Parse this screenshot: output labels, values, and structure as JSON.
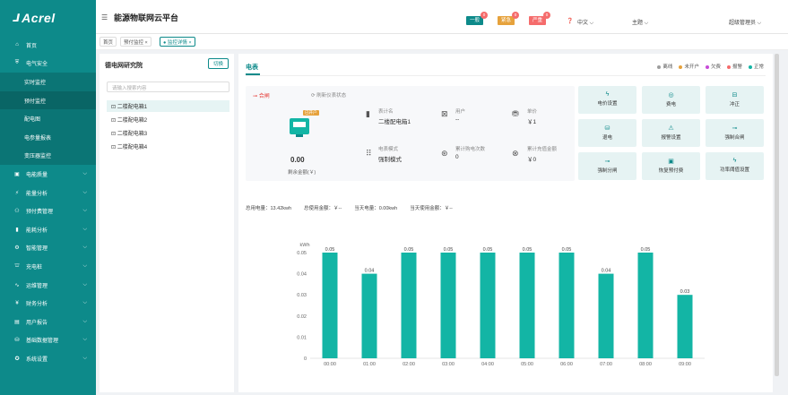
{
  "app": {
    "logo": "Acrel",
    "title": "能源物联网云平台"
  },
  "header": {
    "alarms": [
      {
        "label": "一般",
        "count": "0",
        "color": "#0d8a8a"
      },
      {
        "label": "紧急",
        "count": "0",
        "color": "#e6a23c"
      },
      {
        "label": "严重",
        "count": "0",
        "color": "#f56c6c"
      }
    ],
    "language": "中文",
    "theme": "主题",
    "user": "超级管理员"
  },
  "tags": [
    {
      "label": "首页"
    },
    {
      "label": "预付监控 ×"
    },
    {
      "label": "● 监控详情 ×"
    }
  ],
  "sidebar": {
    "items": [
      {
        "label": "首页",
        "icon": "home-icon"
      },
      {
        "label": "电气安全",
        "icon": "shield-icon"
      },
      {
        "label": "实时监控",
        "icon": "",
        "sub": true
      },
      {
        "label": "预付监控",
        "icon": "",
        "sub": true
      },
      {
        "label": "配电图",
        "icon": "",
        "sub": true
      },
      {
        "label": "电参量报表",
        "icon": "",
        "sub": true
      },
      {
        "label": "变压器监控",
        "icon": "",
        "sub": true
      },
      {
        "label": "电能质量",
        "icon": "monitor-icon"
      },
      {
        "label": "能量分析",
        "icon": "energy-icon"
      },
      {
        "label": "预付费管理",
        "icon": "users-icon"
      },
      {
        "label": "能耗分析",
        "icon": "bar-icon"
      },
      {
        "label": "智能管理",
        "icon": "gear-icon"
      },
      {
        "label": "充电桩",
        "icon": "station-icon"
      },
      {
        "label": "运维管理",
        "icon": "wave-icon"
      },
      {
        "label": "财务分析",
        "icon": "finance-icon"
      },
      {
        "label": "用户报告",
        "icon": "report-icon"
      },
      {
        "label": "基础数据管理",
        "icon": "data-icon"
      },
      {
        "label": "系统设置",
        "icon": "settings-icon"
      }
    ]
  },
  "tree": {
    "title": "德电网研究院",
    "switch_label": "切换",
    "search_placeholder": "请输入搜索内容",
    "items": [
      "二楼配电箱1",
      "二楼配电箱2",
      "二楼配电箱3",
      "二楼配电箱4"
    ]
  },
  "main": {
    "tab": "电表",
    "legend": [
      {
        "label": "离线",
        "color": "#9e9e9e"
      },
      {
        "label": "未开户",
        "color": "#e6a23c"
      },
      {
        "label": "欠费",
        "color": "#c74ad8"
      },
      {
        "label": "报警",
        "color": "#f56c6c"
      },
      {
        "label": "正常",
        "color": "#13b5a5"
      }
    ],
    "status": "合闸",
    "refresh": "刷新仪表状态",
    "meter_tag": "已开户",
    "balance": "0.00",
    "balance_label": "剩余金额(￥)",
    "info": {
      "table_label": "表计名",
      "table_value": "二楼配电箱1",
      "user_label": "用户",
      "user_value": "--",
      "price_label": "单价",
      "price_value": "￥1",
      "mode_label": "电表模式",
      "mode_value": "强制模式",
      "buy_label": "累计购电次数",
      "buy_value": "0",
      "charge_label": "累计充值金额",
      "charge_value": "￥0"
    },
    "actions": [
      "电价设置",
      "费电",
      "冲正",
      "退电",
      "报警设置",
      "强制合闸",
      "强制分闸",
      "恢复预付费",
      "功率阈值设置"
    ],
    "totals": {
      "total_power": "总用电量：13.42kwh",
      "total_amount": "总使用金额：￥--",
      "today_power": "当天电量：0.00kwh",
      "today_amount": "当天使用金额：￥--"
    }
  },
  "chart_data": {
    "type": "bar",
    "ylabel": "kWh",
    "categories": [
      "00:00",
      "01:00",
      "02:00",
      "03:00",
      "04:00",
      "05:00",
      "06:00",
      "07:00",
      "08:00",
      "09:00"
    ],
    "values": [
      0.05,
      0.04,
      0.05,
      0.05,
      0.05,
      0.05,
      0.05,
      0.04,
      0.05,
      0.03
    ],
    "yticks": [
      "0",
      "0.01",
      "0.02",
      "0.03",
      "0.04",
      "0.05"
    ],
    "ylim": [
      0,
      0.05
    ],
    "color": "#13b5a5"
  }
}
